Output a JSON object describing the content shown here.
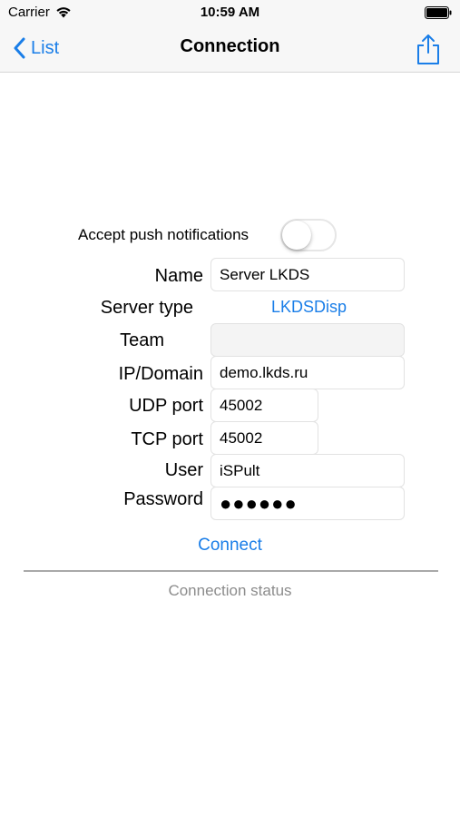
{
  "status_bar": {
    "carrier": "Carrier",
    "time": "10:59 AM"
  },
  "nav": {
    "back_label": "List",
    "title": "Connection"
  },
  "push": {
    "label": "Accept push notifications",
    "enabled": false
  },
  "form": {
    "name_label": "Name",
    "name_value": "Server LKDS",
    "server_type_label": "Server type",
    "server_type_value": "LKDSDisp",
    "team_label": "Team",
    "team_value": "",
    "ip_label": "IP/Domain",
    "ip_value": "demo.lkds.ru",
    "udp_label": "UDP port",
    "udp_value": "45002",
    "tcp_label": "TCP port",
    "tcp_value": "45002",
    "user_label": "User",
    "user_value": "iSPult",
    "password_label": "Password",
    "password_masked": "●●●●●●"
  },
  "connect_label": "Connect",
  "connection_status": "Connection status",
  "colors": {
    "accent": "#1a7ee8",
    "status_gray": "#8c8c8c",
    "bar_background": "#f7f7f7"
  },
  "icons": {
    "wifi": "wifi-icon",
    "battery": "battery-icon",
    "back": "chevron-left-icon",
    "share": "share-icon"
  }
}
